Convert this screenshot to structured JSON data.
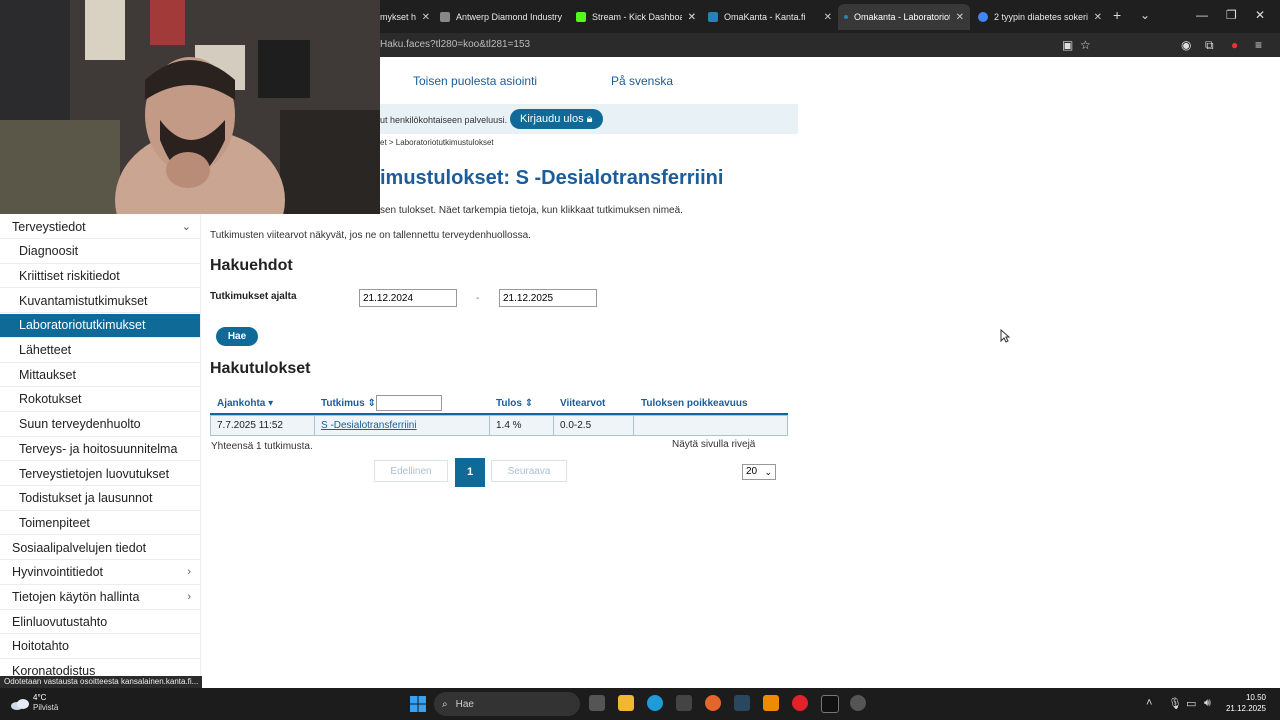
{
  "browser": {
    "tabs": [
      {
        "label": "mykset hi",
        "color": "#7aa0c8"
      },
      {
        "label": "Antwerp Diamond Industry",
        "color": "#888888"
      },
      {
        "label": "Stream - Kick Dashboard",
        "color": "#53fc18"
      },
      {
        "label": "OmaKanta - Kanta.fi",
        "color": "#2d7fb8"
      },
      {
        "label": "Omakanta - Laboratoriotut",
        "color": "#2d7fb8"
      },
      {
        "label": "2 tyypin diabetes sokeriras",
        "color": "#4285f4"
      }
    ],
    "url": "Haku.faces?tl280=koo&tl281=153"
  },
  "header": {
    "link_behalf": "Toisen puolesta asiointi",
    "link_swedish": "På svenska",
    "notice": "ut henkilökohtaiseen palveluusi.",
    "logout": "Kirjaudu ulos",
    "breadcrumb": "et > Laboratoriotutkimustulokset"
  },
  "page": {
    "title": "imustulokset: S -Desialotransferriini",
    "intro": "sen tulokset. Näet tarkempia tietoja, kun klikkaat tutkimuksen nimeä.",
    "reference_note": "Tutkimusten viitearvot näkyvät, jos ne on tallennettu terveydenhuollossa."
  },
  "sidebar": {
    "items": [
      {
        "label": "Terveystiedot",
        "level": "top",
        "chev": "⌄"
      },
      {
        "label": "Diagnoosit",
        "level": "sub"
      },
      {
        "label": "Kriittiset riskitiedot",
        "level": "sub"
      },
      {
        "label": "Kuvantamistutkimukset",
        "level": "sub"
      },
      {
        "label": "Laboratoriotutkimukset",
        "level": "sub",
        "active": true
      },
      {
        "label": "Lähetteet",
        "level": "sub"
      },
      {
        "label": "Mittaukset",
        "level": "sub"
      },
      {
        "label": "Rokotukset",
        "level": "sub"
      },
      {
        "label": "Suun terveydenhuolto",
        "level": "sub"
      },
      {
        "label": "Terveys- ja hoitosuunnitelma",
        "level": "sub"
      },
      {
        "label": "Terveystietojen luovutukset",
        "level": "sub"
      },
      {
        "label": "Todistukset ja lausunnot",
        "level": "sub"
      },
      {
        "label": "Toimenpiteet",
        "level": "sub"
      },
      {
        "label": "Sosiaalipalvelujen tiedot",
        "level": "top"
      },
      {
        "label": "Hyvinvointitiedot",
        "level": "top",
        "chev": "›"
      },
      {
        "label": "Tietojen käytön hallinta",
        "level": "top",
        "chev": "›"
      },
      {
        "label": "Elinluovutustahto",
        "level": "top"
      },
      {
        "label": "Hoitotahto",
        "level": "top"
      },
      {
        "label": "Koronatodistus",
        "level": "top"
      }
    ]
  },
  "search": {
    "heading": "Hakuehdot",
    "range_label": "Tutkimukset ajalta",
    "from": "21.12.2024",
    "separator": "-",
    "to": "21.12.2025",
    "button": "Hae"
  },
  "results": {
    "heading": "Hakutulokset",
    "columns": [
      "Ajankohta ▾",
      "Tutkimus ⇕",
      "Tulos ⇕",
      "Viitearvot",
      "Tuloksen poikkeavuus"
    ],
    "rows": [
      {
        "date": "7.7.2025 11:52",
        "test": "S -Desialotransferriini",
        "result": "1.4 %",
        "reference": "0.0-2.5",
        "deviation": ""
      }
    ],
    "total": "Yhteensä 1 tutkimusta.",
    "per_page_label": "Näytä sivulla rivejä",
    "per_page": "20",
    "prev": "Edellinen",
    "page": "1",
    "next": "Seuraava"
  },
  "status_bar": "Odotetaan vastausta osoitteesta kansalainen.kanta.fi...",
  "taskbar": {
    "temp": "4°C",
    "weather": "Pilvistä",
    "search_placeholder": "Hae",
    "time": "10.50",
    "date": "21.12.2025"
  }
}
